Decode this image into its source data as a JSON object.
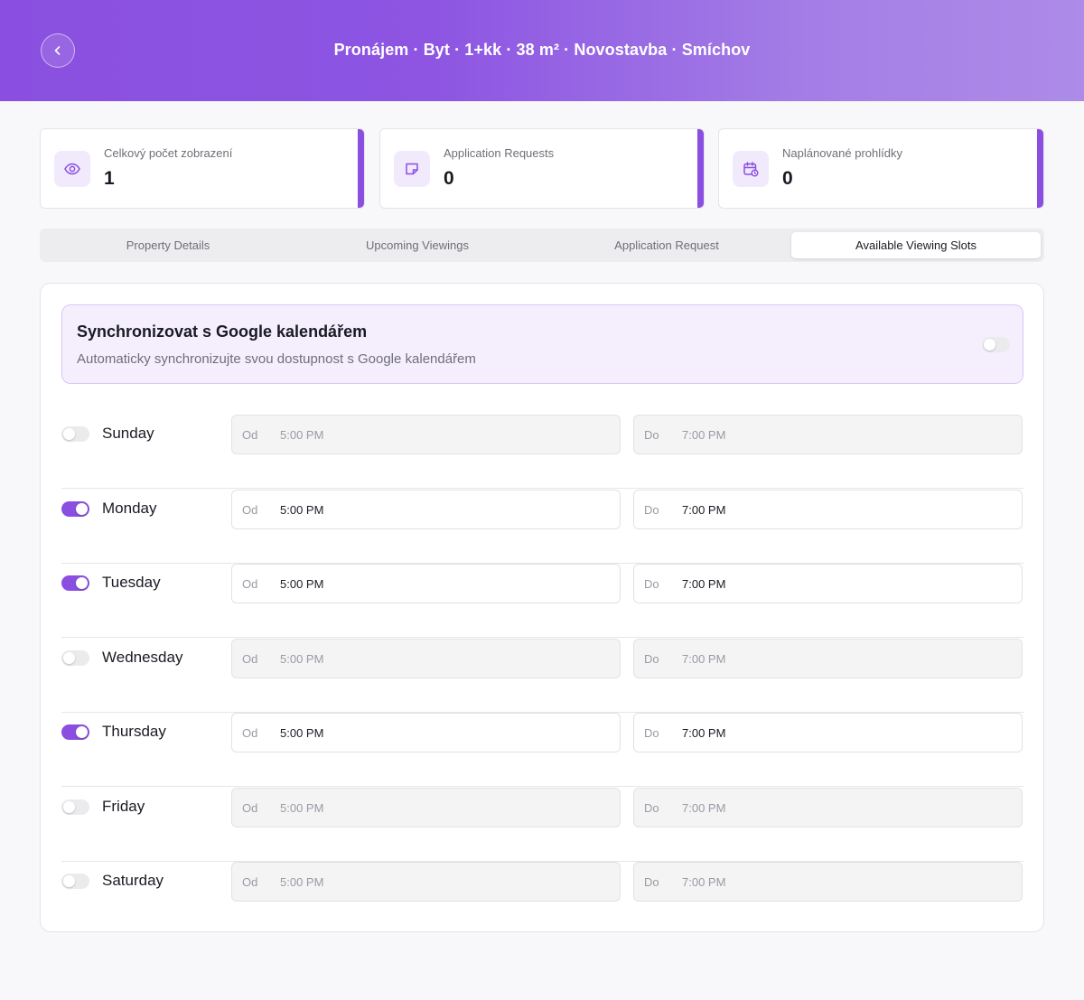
{
  "header": {
    "title": "Pronájem · Byt · 1+kk · 38 m² · Novostavba · Smíchov"
  },
  "stats": [
    {
      "label": "Celkový počet zobrazení",
      "value": "1",
      "icon": "eye-icon"
    },
    {
      "label": "Application Requests",
      "value": "0",
      "icon": "note-icon"
    },
    {
      "label": "Naplánované prohlídky",
      "value": "0",
      "icon": "calendar-clock-icon"
    }
  ],
  "tabs": [
    {
      "label": "Property Details",
      "active": false
    },
    {
      "label": "Upcoming Viewings",
      "active": false
    },
    {
      "label": "Application Request",
      "active": false
    },
    {
      "label": "Available Viewing Slots",
      "active": true
    }
  ],
  "sync": {
    "title": "Synchronizovat s Google kalendářem",
    "description": "Automaticky synchronizujte svou dostupnost s Google kalendářem",
    "enabled": false
  },
  "time_labels": {
    "from": "Od",
    "to": "Do"
  },
  "days": [
    {
      "name": "Sunday",
      "enabled": false,
      "from": "5:00 PM",
      "to": "7:00 PM"
    },
    {
      "name": "Monday",
      "enabled": true,
      "from": "5:00 PM",
      "to": "7:00 PM"
    },
    {
      "name": "Tuesday",
      "enabled": true,
      "from": "5:00 PM",
      "to": "7:00 PM"
    },
    {
      "name": "Wednesday",
      "enabled": false,
      "from": "5:00 PM",
      "to": "7:00 PM"
    },
    {
      "name": "Thursday",
      "enabled": true,
      "from": "5:00 PM",
      "to": "7:00 PM"
    },
    {
      "name": "Friday",
      "enabled": false,
      "from": "5:00 PM",
      "to": "7:00 PM"
    },
    {
      "name": "Saturday",
      "enabled": false,
      "from": "5:00 PM",
      "to": "7:00 PM"
    }
  ],
  "colors": {
    "accent": "#8a4fe0",
    "accent_light": "#f5effd"
  }
}
